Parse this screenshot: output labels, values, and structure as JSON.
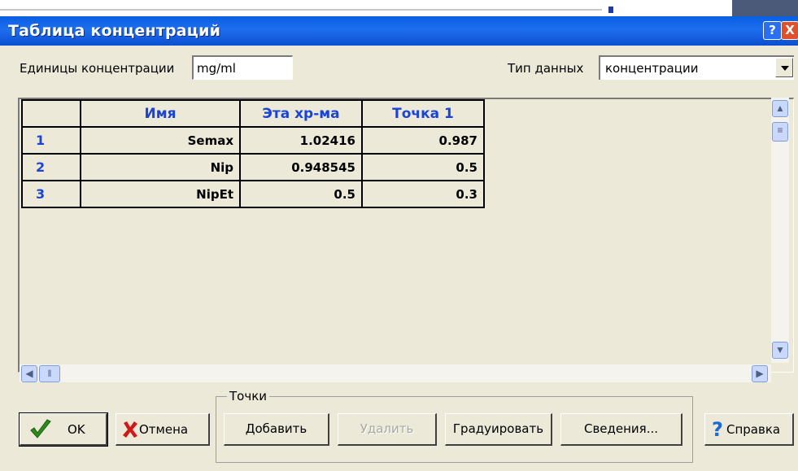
{
  "window": {
    "title": "Таблица концентраций",
    "help_glyph": "?",
    "close_glyph": "X"
  },
  "units": {
    "label": "Единицы концентрации",
    "value": "mg/ml"
  },
  "data_type": {
    "label": "Тип данных",
    "selected": "концентрации"
  },
  "table": {
    "columns": [
      "",
      "Имя",
      "Эта хр-ма",
      "Точка 1"
    ],
    "rows": [
      {
        "idx": "1",
        "name": "Semax",
        "this_chrom": "1.02416",
        "point1": "0.987"
      },
      {
        "idx": "2",
        "name": "Nip",
        "this_chrom": "0.948545",
        "point1": "0.5"
      },
      {
        "idx": "3",
        "name": "NipEt",
        "this_chrom": "0.5",
        "point1": "0.3"
      }
    ]
  },
  "buttons": {
    "ok": "OK",
    "cancel": "Отмена",
    "help": "Справка"
  },
  "points_group": {
    "label": "Точки",
    "add": "Добавить",
    "delete": "Удалить",
    "calibrate": "Градуировать",
    "info": "Сведения..."
  },
  "colors": {
    "title_bar": "#0a5fe0",
    "header_text": "#1a44d6",
    "dialog_bg": "#ece9d8"
  },
  "icons": {
    "ok": "checkmark-icon",
    "cancel": "red-x-icon",
    "help": "question-mark-icon"
  }
}
